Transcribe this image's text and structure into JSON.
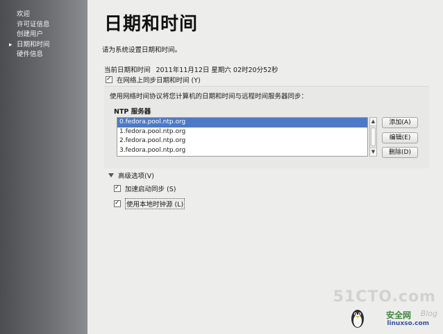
{
  "sidebar": {
    "items": [
      {
        "label": "欢迎",
        "active": false
      },
      {
        "label": "许可证信息",
        "active": false
      },
      {
        "label": "创建用户",
        "active": false
      },
      {
        "label": "日期和时间",
        "active": true
      },
      {
        "label": "硬件信息",
        "active": false
      }
    ]
  },
  "page": {
    "title": "日期和时间",
    "subtitle": "请为系统设置日期和时间。"
  },
  "datetime": {
    "label": "当前日期和时间",
    "value": "2011年11月12日 星期六 02时20分52秒"
  },
  "sync": {
    "checkbox_label": "在网络上同步日期和时间 (Y)",
    "checked": true
  },
  "ntp": {
    "description": "使用网络时间协议将您计算机的日期和时间与远程时间服务器同步：",
    "servers_label": "NTP 服务器",
    "servers": [
      {
        "name": "0.fedora.pool.ntp.org",
        "selected": true
      },
      {
        "name": "1.fedora.pool.ntp.org",
        "selected": false
      },
      {
        "name": "2.fedora.pool.ntp.org",
        "selected": false
      },
      {
        "name": "3.fedora.pool.ntp.org",
        "selected": false
      }
    ],
    "buttons": {
      "add": "添加(A)",
      "edit": "编辑(E)",
      "delete": "删除(D)"
    }
  },
  "advanced": {
    "label": "高级选项(V)",
    "expanded": true,
    "options": [
      {
        "label": "加速启动同步 (S)",
        "checked": true
      },
      {
        "label": "使用本地时钟源 (L)",
        "checked": true
      }
    ]
  },
  "watermark": {
    "site": "51CTO.com",
    "tagline": "安全网",
    "blog": "Blog",
    "url": "linuxso.com"
  }
}
